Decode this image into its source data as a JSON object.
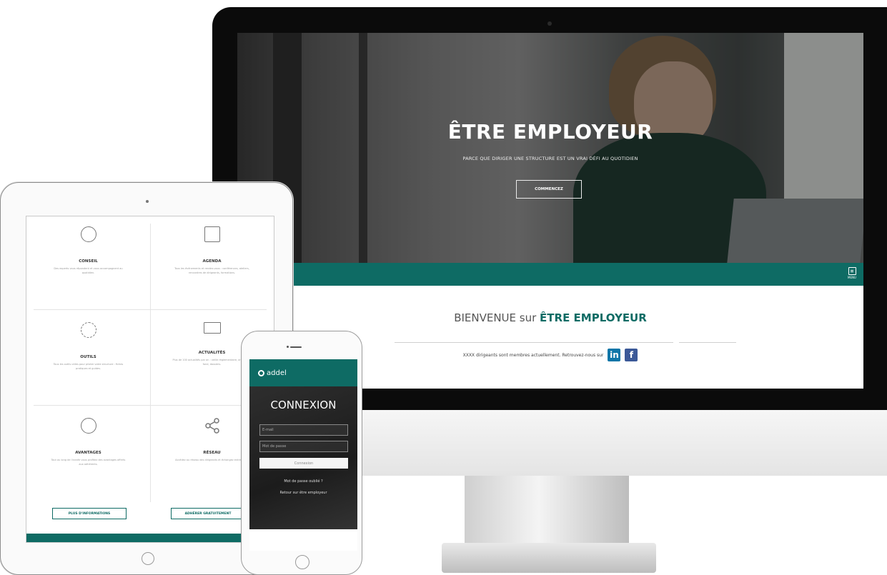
{
  "desktop": {
    "hero_title": "ÊTRE EMPLOYEUR",
    "hero_subtitle": "PARCE QUE DIRIGER UNE STRUCTURE EST UN VRAI DÉFI AU QUOTIDIEN",
    "cta_label": "COMMENCEZ",
    "menu_label": "MENU",
    "welcome_prefix": "BIENVENUE sur ",
    "welcome_brand": "ÊTRE EMPLOYEUR",
    "members_text": "XXXX dirigeants sont membres actuellement. Retrouvez-nous sur",
    "social": {
      "linkedin": "in",
      "facebook": "f"
    },
    "colors": {
      "accent": "#0e6b64",
      "linkedin": "#0e76a8",
      "facebook": "#3b5998"
    }
  },
  "tablet": {
    "cards": [
      {
        "title": "CONSEIL",
        "icon": "compass-icon",
        "desc": "Des experts vous répondent et vous accompagnent au quotidien."
      },
      {
        "title": "AGENDA",
        "icon": "calendar-icon",
        "desc": "Tous les événements et rendez-vous : conférences, ateliers, rencontres de dirigeants, formations."
      },
      {
        "title": "OUTILS",
        "icon": "gear-icon",
        "desc": "Tous les outils utiles pour piloter votre structure : fiches pratiques et guides."
      },
      {
        "title": "ACTUALITÉS",
        "icon": "newspaper-icon",
        "desc": "Plus de 100 actualités par an : veille réglementaire, articles de fond, dossiers."
      },
      {
        "title": "AVANTAGES",
        "icon": "plus-icon",
        "desc": "Tout au long de l'année vous profitez des avantages offerts aux adhérents."
      },
      {
        "title": "RÉSEAU",
        "icon": "share-icon",
        "desc": "Accédez au réseau des dirigeants et échangez entre pairs."
      }
    ],
    "more_info_label": "PLUS D'INFORMATIONS",
    "join_label": "ADHÉRER GRATUITEMENT"
  },
  "phone": {
    "brand": "addel",
    "title": "CONNEXION",
    "email_placeholder": "E-mail",
    "password_placeholder": "Mot de passe",
    "login_label": "Connexion",
    "forgot_label": "Mot de passe oublié ?",
    "back_label": "Retour sur être employeur"
  }
}
